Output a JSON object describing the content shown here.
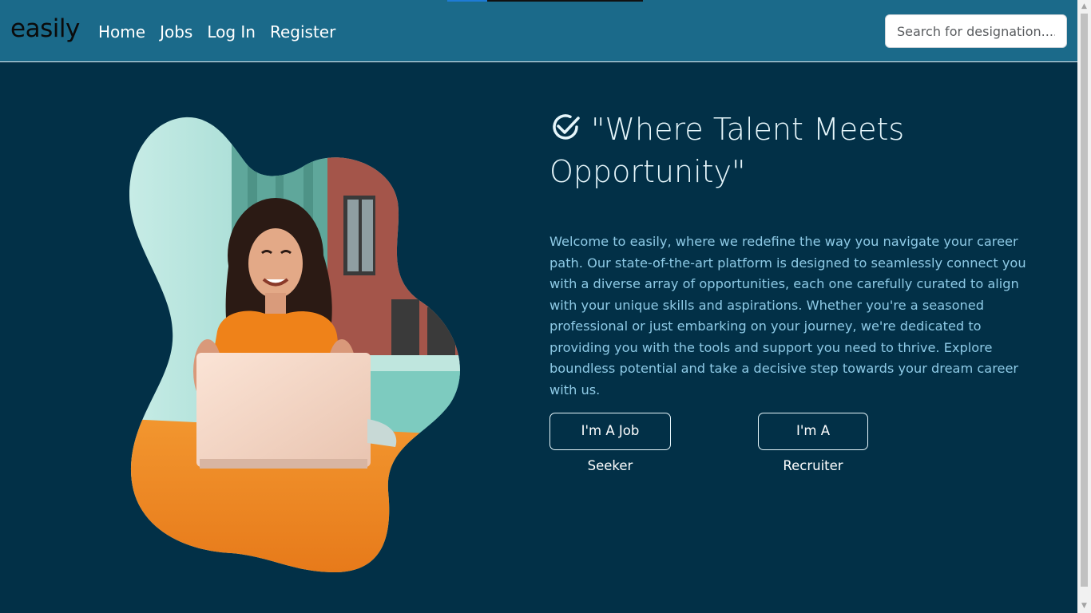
{
  "navbar": {
    "brand": "easily",
    "links": [
      "Home",
      "Jobs",
      "Log In",
      "Register"
    ],
    "search": {
      "placeholder": "Search for designation....",
      "value": ""
    }
  },
  "hero": {
    "title": "\"Where Talent Meets Opportunity\"",
    "description": "Welcome to easily, where we redefine the way you navigate your career path. Our state-of-the-art platform is designed to seamlessly connect you with a diverse array of opportunities, each one carefully curated to align with your unique skills and aspirations. Whether you're a seasoned professional or just embarking on your journey, we're dedicated to providing you with the tools and support you need to thrive. Explore boundless potential and take a decisive step towards your dream career with us.",
    "buttons": {
      "job_seeker": "I'm A Job Seeker",
      "recruiter": "I'm A Recruiter"
    },
    "image_icon": "woman-laptop-photo"
  },
  "colors": {
    "navbar_bg": "#1b6a8a",
    "page_bg": "#023047",
    "title_text": "#e6f6fb",
    "desc_text": "#8ecae6"
  }
}
